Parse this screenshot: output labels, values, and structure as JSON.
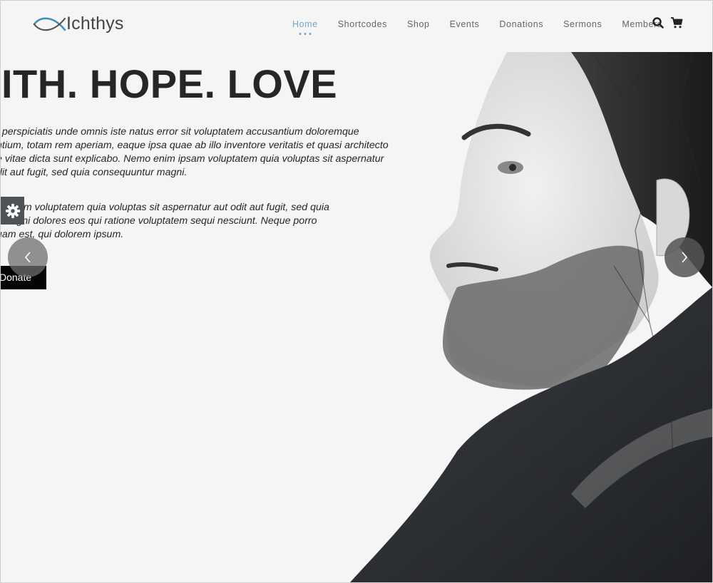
{
  "brand": {
    "name": "Ichthys",
    "accent": "#6fa8c7",
    "logo_color": "#3f8fb8"
  },
  "nav": {
    "items": [
      {
        "label": "Home",
        "active": true
      },
      {
        "label": "Shortcodes",
        "active": false
      },
      {
        "label": "Shop",
        "active": false
      },
      {
        "label": "Events",
        "active": false
      },
      {
        "label": "Donations",
        "active": false
      },
      {
        "label": "Sermons",
        "active": false
      },
      {
        "label": "Members",
        "active": false
      }
    ],
    "icons": [
      "search-icon",
      "cart-icon"
    ]
  },
  "hero": {
    "title": "AITH. HOPE. LOVE",
    "paragraph1": [
      "t perspiciatis unde omnis iste natus error sit voluptatem accusantium doloremque",
      "ntium, totam rem aperiam, eaque ipsa quae ab illo inventore veritatis et quasi architecto",
      "e vitae dicta sunt explicabo. Nemo enim ipsam voluptatem quia voluptas sit aspernatur",
      "dit aut fugit, sed quia consequuntur magni."
    ],
    "paragraph2": [
      "n ipsam voluptatem quia voluptas sit aspernatur aut odit aut fugit, sed quia",
      "r magni dolores eos qui ratione voluptatem sequi nesciunt. Neque porro",
      "uam est, qui dolorem ipsum."
    ],
    "button_label": "Donate"
  },
  "controls": {
    "settings": "gear-icon",
    "prev": "chevron-left-icon",
    "next": "chevron-right-icon"
  }
}
